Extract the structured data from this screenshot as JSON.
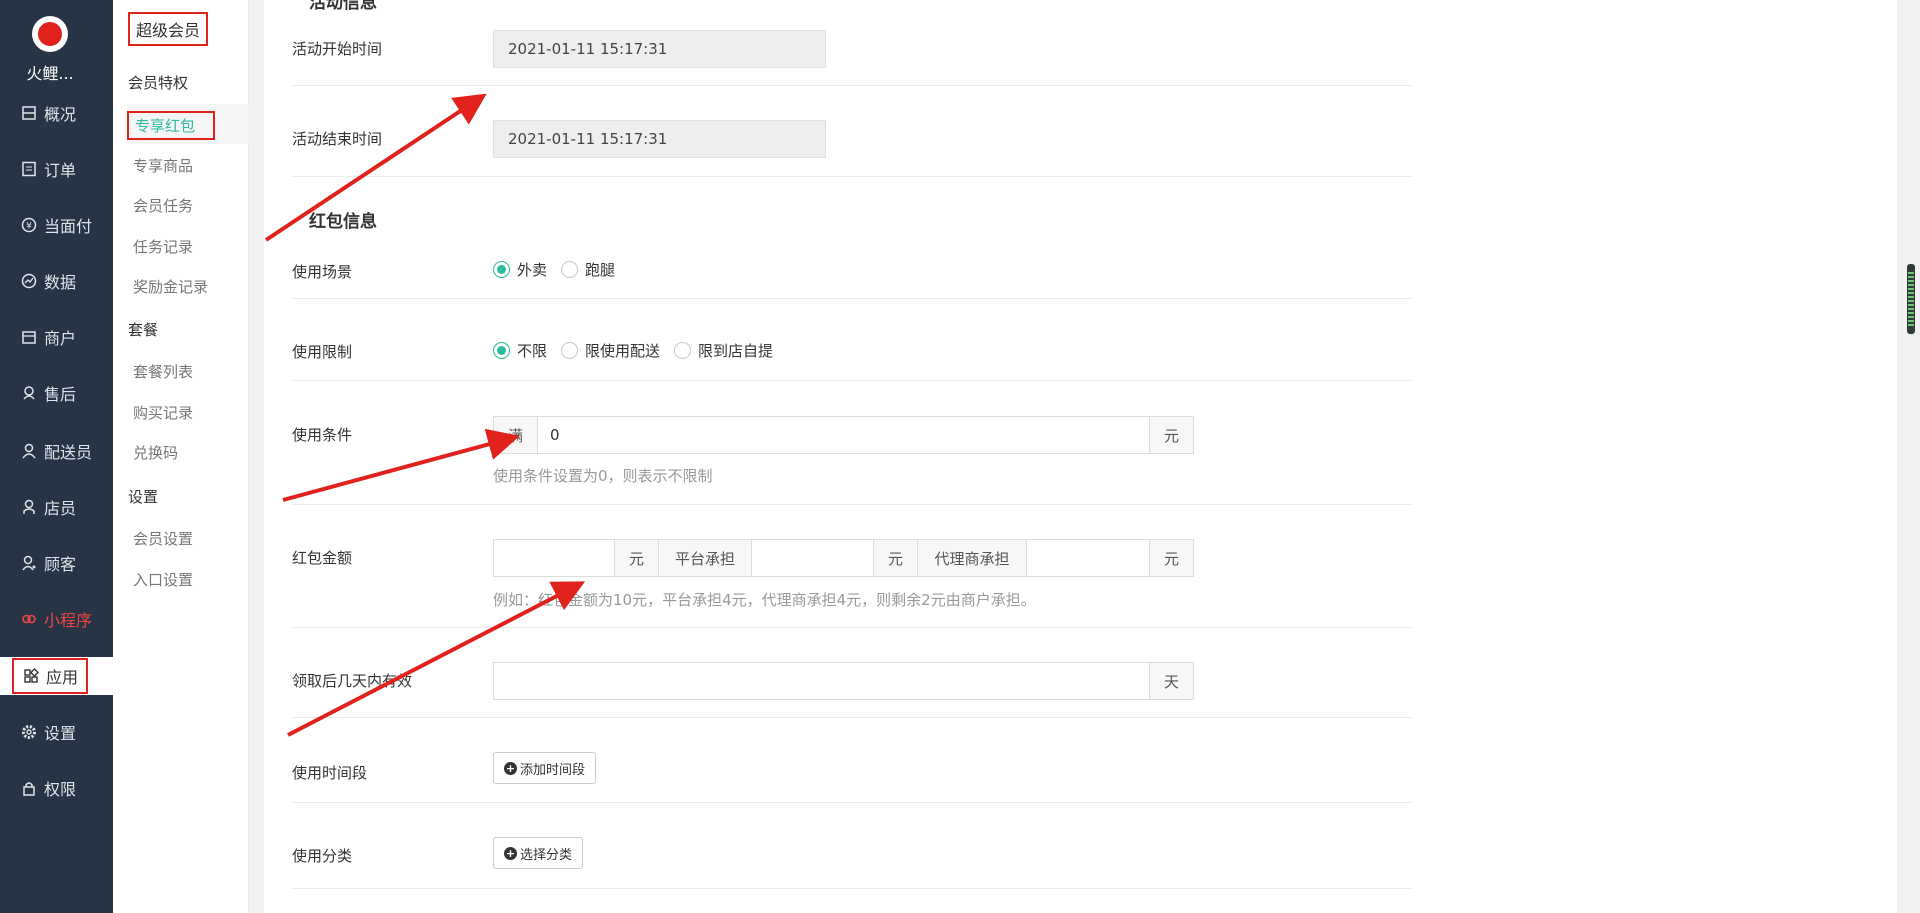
{
  "brand": "火鲤...",
  "nav": [
    {
      "label": "概况",
      "icon": "overview-icon"
    },
    {
      "label": "订单",
      "icon": "order-icon"
    },
    {
      "label": "当面付",
      "icon": "yuan-icon"
    },
    {
      "label": "数据",
      "icon": "chart-icon"
    },
    {
      "label": "商户",
      "icon": "store-icon"
    },
    {
      "label": "售后",
      "icon": "aftersale-icon"
    },
    {
      "label": "配送员",
      "icon": "courier-icon"
    },
    {
      "label": "店员",
      "icon": "clerk-icon"
    },
    {
      "label": "顾客",
      "icon": "customer-icon"
    },
    {
      "label": "小程序",
      "icon": "miniprogram-icon"
    },
    {
      "label": "应用",
      "icon": "apps-icon"
    },
    {
      "label": "设置",
      "icon": "gear-icon"
    },
    {
      "label": "权限",
      "icon": "lock-icon"
    }
  ],
  "sub": {
    "title": "超级会员",
    "groups": [
      {
        "label": "会员特权",
        "items": [
          "专享红包",
          "专享商品",
          "会员任务",
          "任务记录",
          "奖励金记录"
        ]
      },
      {
        "label": "套餐",
        "items": [
          "套餐列表",
          "购买记录",
          "兑换码"
        ]
      },
      {
        "label": "设置",
        "items": [
          "会员设置",
          "入口设置"
        ]
      }
    ]
  },
  "form": {
    "activity_section": "活动信息",
    "start_label": "活动开始时间",
    "start_value": "2021-01-11 15:17:31",
    "end_label": "活动结束时间",
    "end_value": "2021-01-11 15:17:31",
    "redpack_section": "红包信息",
    "scene_label": "使用场景",
    "scene_options": [
      "外卖",
      "跑腿"
    ],
    "scene_selected": "外卖",
    "limit_label": "使用限制",
    "limit_options": [
      "不限",
      "限使用配送",
      "限到店自提"
    ],
    "limit_selected": "不限",
    "cond_label": "使用条件",
    "cond_prefix": "满",
    "cond_value": "0",
    "cond_suffix": "元",
    "cond_hint": "使用条件设置为0，则表示不限制",
    "amount_label": "红包金额",
    "amount_unit": "元",
    "platform_label": "平台承担",
    "platform_unit": "元",
    "agent_label": "代理商承担",
    "agent_unit": "元",
    "amount_hint": "例如：红包金额为10元，平台承担4元，代理商承担4元，则剩余2元由商户承担。",
    "valid_label": "领取后几天内有效",
    "valid_unit": "天",
    "period_label": "使用时间段",
    "period_button": "添加时间段",
    "category_label": "使用分类",
    "category_button": "选择分类"
  },
  "colors": {
    "accent": "#2bbba0",
    "annotation": "#e0211c",
    "sidebar": "#263445"
  }
}
